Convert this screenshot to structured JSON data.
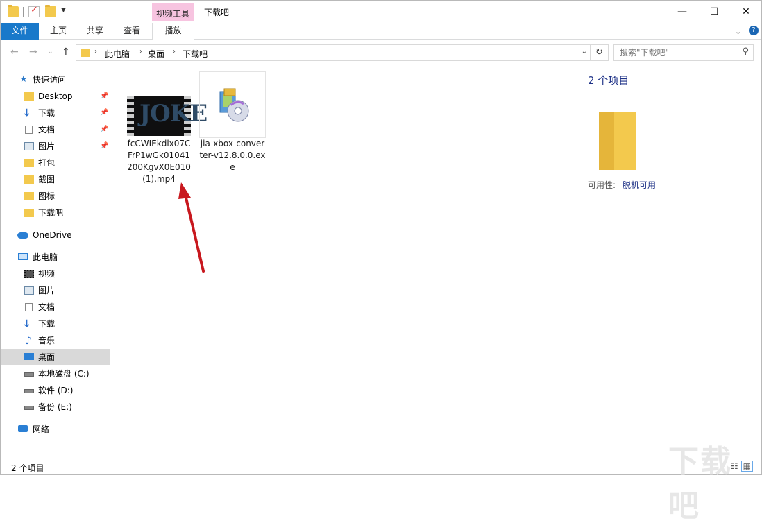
{
  "window": {
    "title": "下载吧",
    "context_tab_group": "视频工具",
    "controls": {
      "minimize": "—",
      "maximize": "☐",
      "close": "✕"
    }
  },
  "ribbon": {
    "tabs": [
      {
        "label": "文件",
        "active": true
      },
      {
        "label": "主页"
      },
      {
        "label": "共享"
      },
      {
        "label": "查看"
      },
      {
        "label": "播放"
      }
    ],
    "collapse_icon": "chevron-down-icon",
    "help_icon": "help-icon"
  },
  "address": {
    "crumbs": [
      "此电脑",
      "桌面",
      "下载吧"
    ],
    "search_placeholder": "搜索\"下载吧\""
  },
  "nav": {
    "quick_access": "快速访问",
    "pinned": [
      "Desktop",
      "下载",
      "文档",
      "图片"
    ],
    "folders": [
      "打包",
      "截图",
      "图标",
      "下载吧"
    ],
    "onedrive": "OneDrive",
    "this_pc": "此电脑",
    "pc_items": [
      "视频",
      "图片",
      "文档",
      "下载",
      "音乐",
      "桌面"
    ],
    "drives": [
      "本地磁盘 (C:)",
      "软件 (D:)",
      "备份 (E:)"
    ],
    "network": "网络",
    "selected": "桌面"
  },
  "files": [
    {
      "name": "fcCWIEkdlx07CFrP1wGk01041200KgvX0E010(1).mp4",
      "thumb_text": "JOKE"
    },
    {
      "name": "jia-xbox-converter-v12.8.0.0.exe"
    }
  ],
  "preview": {
    "count": "2 个项目",
    "availability_label": "可用性:",
    "availability_value": "脱机可用"
  },
  "status": {
    "text": "2 个项目"
  },
  "watermark": "下载吧",
  "colors": {
    "accent": "#1979ca",
    "context_tab": "#f7c4e0",
    "folder": "#f3c94d",
    "selected": "#d9d9d9",
    "arrow": "#c8181e"
  }
}
